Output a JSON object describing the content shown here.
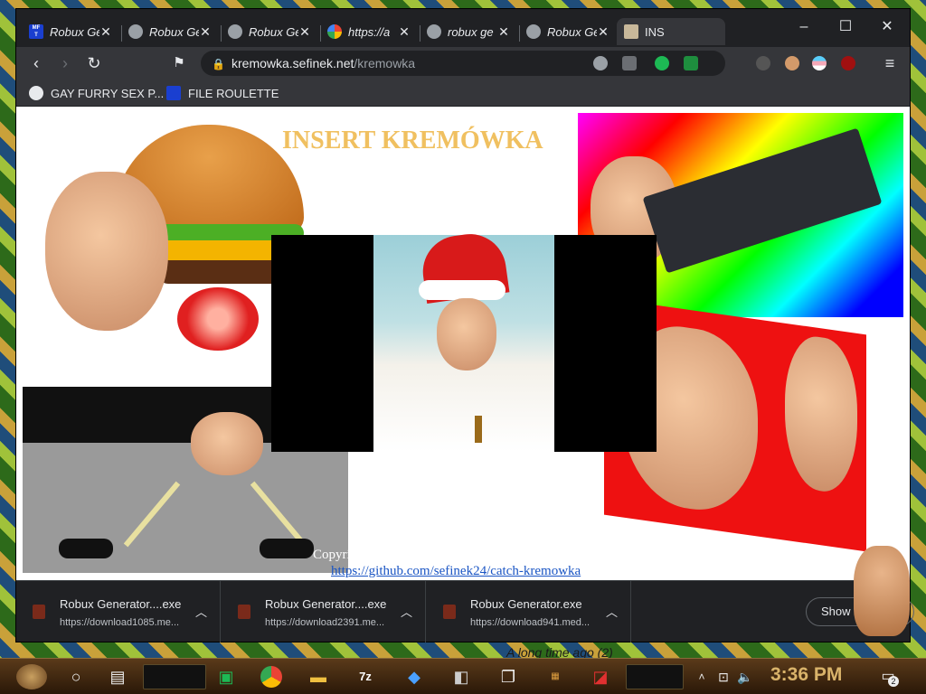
{
  "tabs": [
    {
      "title": "Robux Ge",
      "icon": "mft-icon"
    },
    {
      "title": "Robux Ge",
      "icon": "globe-icon"
    },
    {
      "title": "Robux Ge",
      "icon": "globe-icon"
    },
    {
      "title": "https://a",
      "icon": "google-icon"
    },
    {
      "title": "robux ge",
      "icon": "globe-icon"
    },
    {
      "title": "Robux Ge",
      "icon": "globe-icon"
    },
    {
      "title": "INS",
      "icon": "box-icon",
      "active": true
    }
  ],
  "window_controls": {
    "minimize": "–",
    "maximize": "☐",
    "close": "✕"
  },
  "toolbar": {
    "url_host": "kremowka.sefinek.net",
    "url_path": "/kremowka"
  },
  "bookmarks": [
    {
      "label": "GAY FURRY SEX P...",
      "icon": "globe-icon"
    },
    {
      "label": "FILE ROULETTE",
      "icon": "mft-icon"
    }
  ],
  "page": {
    "title": "INSERT KREMÓWKA",
    "copyright": "Copyright",
    "github_link": "https://github.com/sefinek24/catch-kremowka"
  },
  "downloads": [
    {
      "name": "Robux Generator....exe",
      "url": "https://download1085.me..."
    },
    {
      "name": "Robux Generator....exe",
      "url": "https://download2391.me..."
    },
    {
      "name": "Robux Generator.exe",
      "url": "https://download941.med..."
    }
  ],
  "downloads_show_all": "Show a",
  "taskbar": {
    "clock": "3:36 PM",
    "notification_count": "2",
    "desktop_text": "A long time ago (2)"
  },
  "colors": {
    "browser_bg": "#202124",
    "toolbar_bg": "#35363a",
    "title_color": "#f0c060",
    "link_color": "#1a55c4"
  }
}
